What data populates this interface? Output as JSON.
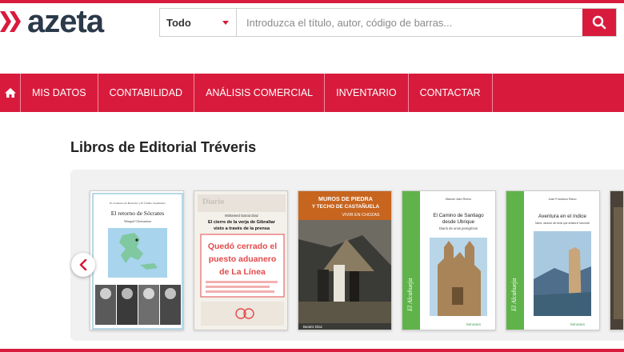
{
  "brand": {
    "name": "azeta",
    "accent": "#d81b3c",
    "dark": "#2b3a4a"
  },
  "search": {
    "category": "Todo",
    "placeholder": "Introduzca el título, autor, código de barras...",
    "button_icon": "search-icon"
  },
  "nav": {
    "home_icon": "home-icon",
    "items": [
      "MIS DATOS",
      "CONTABILIDAD",
      "ANÁLISIS COMERCIAL",
      "INVENTARIO",
      "CONTACTAR"
    ]
  },
  "section": {
    "title": "Libros de Editorial Tréveris"
  },
  "carousel": {
    "prev_icon": "chevron-left-icon",
    "books": [
      {
        "series": "El Cuaderno de Heráclito y El Último Testamento",
        "title": "El retorno de Sócrates",
        "author": "Wenguil Choirunnisa"
      },
      {
        "author": "Mohamed Garcia Diaz",
        "title_line1": "El cierre de la verja de Gibraltar",
        "title_line2": "visto a través de la prensa",
        "headline1": "Quedó cerrado el",
        "headline2": "puesto aduanero",
        "headline3": "de La Línea"
      },
      {
        "title_line1": "MUROS DE PIEDRA",
        "title_line2": "Y TECHO DE CASTAÑUELA",
        "subtitle": "VIVIR EN CHOZAS",
        "author": "Beatriz Díaz"
      },
      {
        "author": "Manuel Jaén Rivero",
        "title_line1": "El Camino de Santiago",
        "title_line2": "desde Ubrique",
        "subtitle": "Diario de unos peregrinos",
        "spine": "El Alcahueja",
        "publisher": "TREVERIS"
      },
      {
        "author": "Juan Francisco Ramo",
        "title": "Aventura en el índice",
        "subtitle": "Índice, alcance del dedo que señala el horizonte",
        "spine": "El Alcahueja",
        "publisher": "TREVERIS"
      }
    ]
  }
}
